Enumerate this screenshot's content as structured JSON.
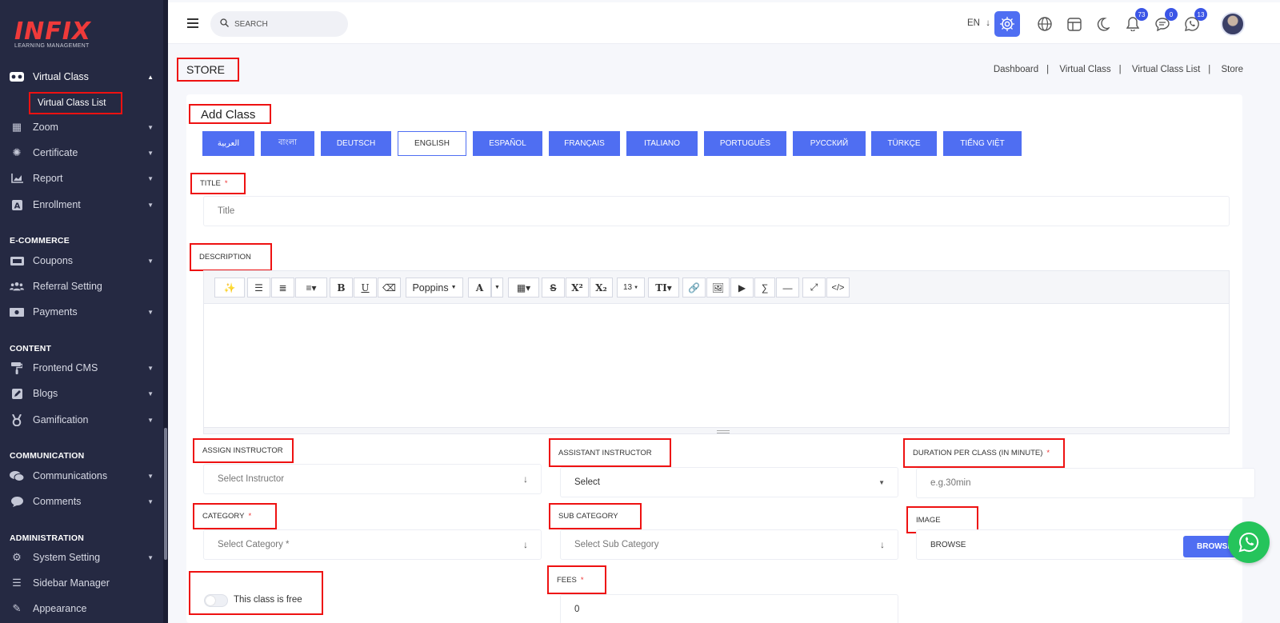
{
  "brand": {
    "logo_text": "INFIX",
    "logo_subtitle": "LEARNING MANAGEMENT"
  },
  "sidebar": {
    "items": [
      {
        "label": "Virtual Class",
        "icon": "vr-headset-icon",
        "top": 0
      },
      {
        "label": "Zoom",
        "icon": "grid-icon"
      },
      {
        "label": "Certificate",
        "icon": "certificate-icon"
      },
      {
        "label": "Report",
        "icon": "chart-icon"
      },
      {
        "label": "Enrollment",
        "icon": "enrollment-icon"
      },
      {
        "label": "Coupons",
        "icon": "coupon-icon"
      },
      {
        "label": "Referral Setting",
        "icon": "users-icon"
      },
      {
        "label": "Payments",
        "icon": "money-icon"
      },
      {
        "label": "Frontend CMS",
        "icon": "paint-roller-icon"
      },
      {
        "label": "Blogs",
        "icon": "edit-icon"
      },
      {
        "label": "Gamification",
        "icon": "medal-icon"
      },
      {
        "label": "Communications",
        "icon": "chat-icon"
      },
      {
        "label": "Comments",
        "icon": "comment-icon"
      },
      {
        "label": "System Setting",
        "icon": "gears-icon"
      },
      {
        "label": "Sidebar Manager",
        "icon": "bars-icon"
      },
      {
        "label": "Appearance",
        "icon": "brush-icon"
      }
    ],
    "subitem": "Virtual Class List",
    "sections": [
      "E-COMMERCE",
      "CONTENT",
      "COMMUNICATION",
      "ADMINISTRATION"
    ]
  },
  "header": {
    "search_placeholder": "SEARCH",
    "language": "EN",
    "badges": {
      "notifications": "73",
      "messages": "0",
      "whatsapp": "13"
    }
  },
  "page": {
    "title": "STORE",
    "breadcrumb": [
      "Dashboard",
      "Virtual Class",
      "Virtual Class List",
      "Store"
    ]
  },
  "form": {
    "card_title": "Add Class",
    "languages": [
      "العربية",
      "বাংলা",
      "DEUTSCH",
      "ENGLISH",
      "ESPAÑOL",
      "FRANÇAIS",
      "ITALIANO",
      "PORTUGUÊS",
      "РУССКИЙ",
      "TÜRKÇE",
      "TIẾNG VIỆT"
    ],
    "active_language": "ENGLISH",
    "title_label": "TITLE",
    "title_placeholder": "Title",
    "description_label": "DESCRIPTION",
    "editor": {
      "font_name": "Poppins",
      "font_size": "13"
    },
    "assign_instructor_label": "ASSIGN INSTRUCTOR",
    "assign_instructor_placeholder": "Select Instructor",
    "assistant_instructor_label": "ASSISTANT INSTRUCTOR",
    "assistant_instructor_value": "Select",
    "duration_label": "DURATION PER CLASS (IN MINUTE)",
    "duration_placeholder": "e.g.30min",
    "category_label": "CATEGORY",
    "category_placeholder": "Select Category *",
    "sub_category_label": "SUB CATEGORY",
    "sub_category_placeholder": "Select Sub Category",
    "image_label": "IMAGE",
    "image_placeholder": "BROWSE",
    "browse_button": "BROWSE",
    "free_toggle_label": "This class is free",
    "free_toggle_on": false,
    "fees_label": "FEES",
    "fees_value": "0",
    "required_mark": "*"
  },
  "colors": {
    "accent": "#4f6ef2",
    "sidebar_bg": "#252942",
    "highlight_border": "#ee1111",
    "whatsapp": "#25c45b"
  }
}
